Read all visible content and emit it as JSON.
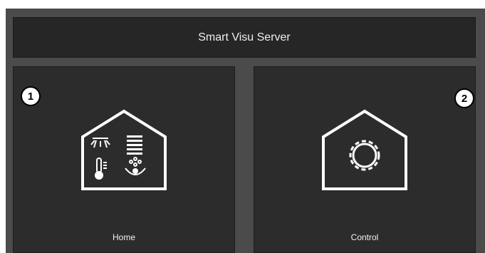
{
  "header": {
    "title": "Smart Visu Server"
  },
  "tiles": [
    {
      "label": "Home",
      "icon": "house-smart-home-icon"
    },
    {
      "label": "Control",
      "icon": "house-gear-icon"
    }
  ],
  "markers": [
    "1",
    "2"
  ],
  "colors": {
    "background": "#4b4b4b",
    "panel": "#2c2c2c",
    "header": "#262626",
    "text": "#eeeeee",
    "icon": "#ffffff"
  }
}
